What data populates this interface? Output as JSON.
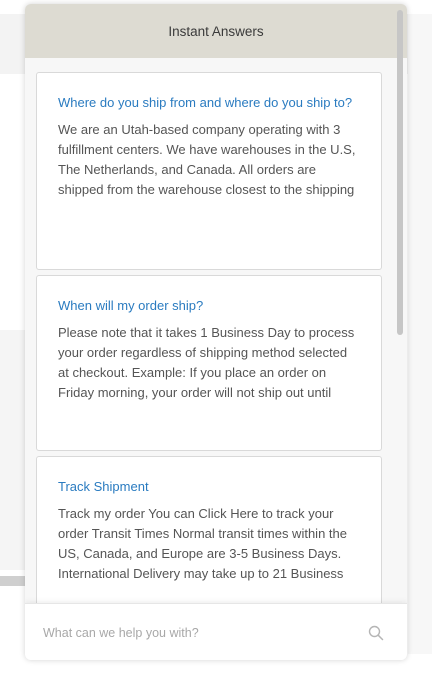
{
  "header": {
    "title": "Instant Answers"
  },
  "answers": [
    {
      "title": "Where do you ship from and where do you ship to?",
      "body": "We are an Utah-based company operating with 3 fulfillment centers. We have warehouses in the U.S, The Netherlands, and Canada. All orders are shipped from the warehouse closest to the shipping"
    },
    {
      "title": "When will my order ship?",
      "body": "Please note that it takes 1 Business Day to process your order regardless of shipping method selected at checkout. Example: If you place an order on Friday morning, your order will not ship out until"
    },
    {
      "title": "Track Shipment",
      "body": "Track my order You can Click Here to track your order Transit Times Normal transit times within the US, Canada, and Europe are 3-5 Business Days. International Delivery may take up to 21 Business"
    }
  ],
  "search": {
    "placeholder": "What can we help you with?",
    "value": ""
  },
  "icons": {
    "search": "search-icon"
  },
  "colors": {
    "header_bg": "#dddbd2",
    "link_blue": "#2a7bc0",
    "body_text": "#555555"
  }
}
